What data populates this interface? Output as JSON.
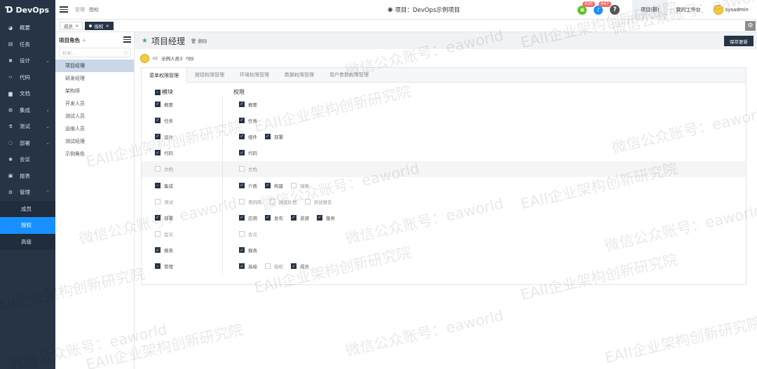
{
  "app": {
    "name": "DevOps"
  },
  "sidebar": {
    "items": [
      {
        "label": "概要",
        "icon": "dashboard-icon",
        "glyph": "◕"
      },
      {
        "label": "任务",
        "icon": "task-icon",
        "glyph": "▤"
      },
      {
        "label": "设计",
        "icon": "design-icon",
        "glyph": "✖",
        "chevron": "⌄"
      },
      {
        "label": "代码",
        "icon": "code-icon",
        "glyph": "‹›"
      },
      {
        "label": "文档",
        "icon": "document-icon",
        "glyph": "▆"
      },
      {
        "label": "集成",
        "icon": "integration-icon",
        "glyph": "◍",
        "chevron": "⌄"
      },
      {
        "label": "测试",
        "icon": "test-icon",
        "glyph": "⚗",
        "chevron": "⌄"
      },
      {
        "label": "部署",
        "icon": "deploy-icon",
        "glyph": "◌",
        "chevron": "⌄"
      },
      {
        "label": "会议",
        "icon": "meeting-icon",
        "glyph": "✱"
      },
      {
        "label": "报表",
        "icon": "report-icon",
        "glyph": "▣"
      },
      {
        "label": "管理",
        "icon": "admin-gear-icon",
        "glyph": "⚙",
        "chevron": "⌃"
      }
    ],
    "subitems": [
      {
        "label": "成员"
      },
      {
        "label": "授权"
      },
      {
        "label": "高级"
      }
    ]
  },
  "topbar": {
    "breadcrumb": [
      "管理",
      "授权"
    ],
    "project_title": "项目：DevOps示例项目",
    "badges": [
      {
        "icon": "green-clipboard-icon",
        "count": "630",
        "color": "#52c41a"
      },
      {
        "icon": "bell-icon",
        "count": "647",
        "color": "#1890ff"
      }
    ],
    "help": "?",
    "links": [
      "项目(群)",
      "我的工作台"
    ],
    "username": "sysadmin"
  },
  "tagbar": {
    "tags": [
      "成员",
      "授权"
    ],
    "close_glyph": "×"
  },
  "roles": {
    "title": "项目角色",
    "add": "+",
    "search_placeholder": "检索...",
    "items": [
      "项目经理",
      "研发经理",
      "架构师",
      "开发人员",
      "测试人员",
      "运维人员",
      "测试经理",
      "示例角色"
    ]
  },
  "content": {
    "title": "项目经理",
    "delete_label": "删除",
    "save_label": "保存更新",
    "members": [
      "cc",
      "示例人员3",
      "rgg"
    ],
    "tabs": [
      "菜单权限管理",
      "按钮权限管理",
      "环境权限管理",
      "数据权限管理",
      "用户参数权限管理"
    ],
    "col_module": "模块",
    "col_permission": "权限",
    "rows": [
      {
        "module": "概要",
        "state": "on",
        "perms": [
          {
            "label": "概要",
            "on": true
          }
        ]
      },
      {
        "module": "任务",
        "state": "on",
        "perms": [
          {
            "label": "任务",
            "on": true
          }
        ]
      },
      {
        "module": "设计",
        "state": "on",
        "perms": [
          {
            "label": "组件",
            "on": true
          },
          {
            "label": "部署",
            "on": true
          }
        ]
      },
      {
        "module": "代码",
        "state": "on",
        "perms": [
          {
            "label": "代码",
            "on": true
          }
        ]
      },
      {
        "module": "文档",
        "state": "off",
        "perms": [
          {
            "label": "文档",
            "on": false
          }
        ]
      },
      {
        "module": "集成",
        "state": "ind",
        "perms": [
          {
            "label": "介质",
            "on": true
          },
          {
            "label": "构建",
            "on": true
          },
          {
            "label": "镜像",
            "on": false
          }
        ]
      },
      {
        "module": "测试",
        "state": "off",
        "perms": [
          {
            "label": "用例库",
            "on": false
          },
          {
            "label": "测试计划",
            "on": false
          },
          {
            "label": "测试报告",
            "on": false
          }
        ]
      },
      {
        "module": "部署",
        "state": "on",
        "perms": [
          {
            "label": "应用",
            "on": true
          },
          {
            "label": "发布",
            "on": true
          },
          {
            "label": "资源",
            "on": true
          },
          {
            "label": "服务",
            "on": true
          }
        ]
      },
      {
        "module": "会议",
        "state": "off",
        "perms": [
          {
            "label": "会议",
            "on": false
          }
        ]
      },
      {
        "module": "报表",
        "state": "on",
        "perms": [
          {
            "label": "报表",
            "on": true
          }
        ]
      },
      {
        "module": "管理",
        "state": "ind",
        "perms": [
          {
            "label": "高级",
            "on": true
          },
          {
            "label": "授权",
            "on": false
          },
          {
            "label": "成员",
            "on": true
          }
        ]
      }
    ]
  },
  "watermark": [
    "EAII企业架构创新研究院",
    "微信公众账号：eaworld"
  ]
}
